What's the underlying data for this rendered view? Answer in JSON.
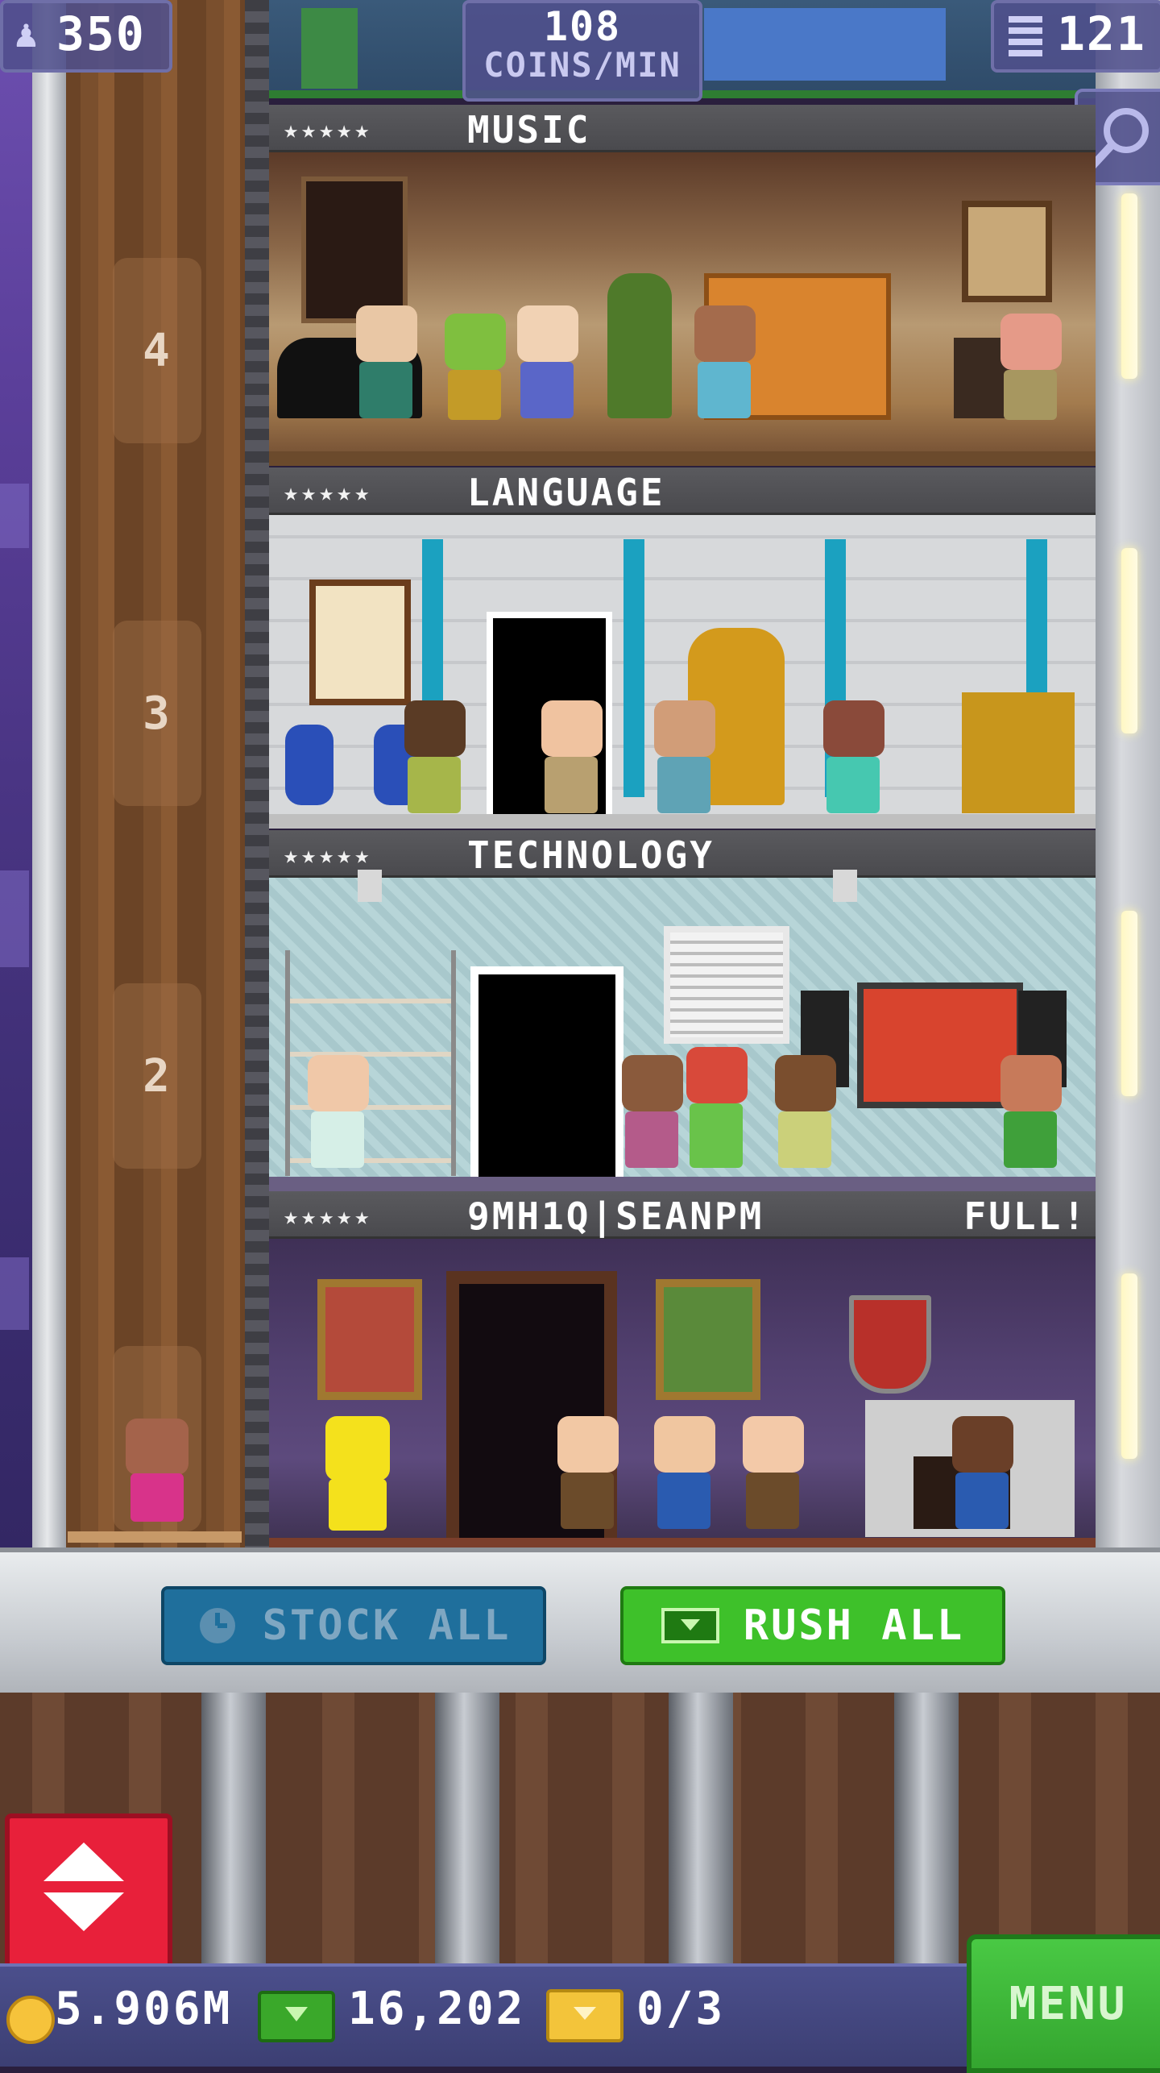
{
  "hud": {
    "population": "350",
    "coins_rate_value": "108",
    "coins_rate_unit": "COINS/MIN",
    "floors": "121"
  },
  "floors": [
    {
      "stars": "★★★★★",
      "name": "MUSIC",
      "status": ""
    },
    {
      "stars": "★★★★★",
      "name": "LANGUAGE",
      "status": ""
    },
    {
      "stars": "★★★★★",
      "name": "TECHNOLOGY",
      "status": ""
    },
    {
      "stars": "★★★★★",
      "name": "9MH1Q|SEANPM",
      "status": "FULL!"
    }
  ],
  "elevator": {
    "floor_numbers": [
      "4",
      "3",
      "2"
    ]
  },
  "actions": {
    "stock_all": "STOCK ALL",
    "rush_all": "RUSH ALL"
  },
  "bottom": {
    "coins": "5.906M",
    "bux": "16,202",
    "tickets": "0/3",
    "menu": "MENU"
  },
  "icons": {
    "population": "person-icon",
    "floors": "building-icon",
    "search": "magnifier-icon",
    "stock": "clock-icon",
    "rush": "bux-icon",
    "elevator": "elevator-arrows-icon",
    "coins": "coin-icon",
    "bux": "bux-icon",
    "tickets": "ticket-icon"
  },
  "colors": {
    "rush_green": "#3ec12a",
    "stock_blue": "#1f6f9c",
    "elevator_red": "#e8203a",
    "menu_green": "#49c944"
  }
}
